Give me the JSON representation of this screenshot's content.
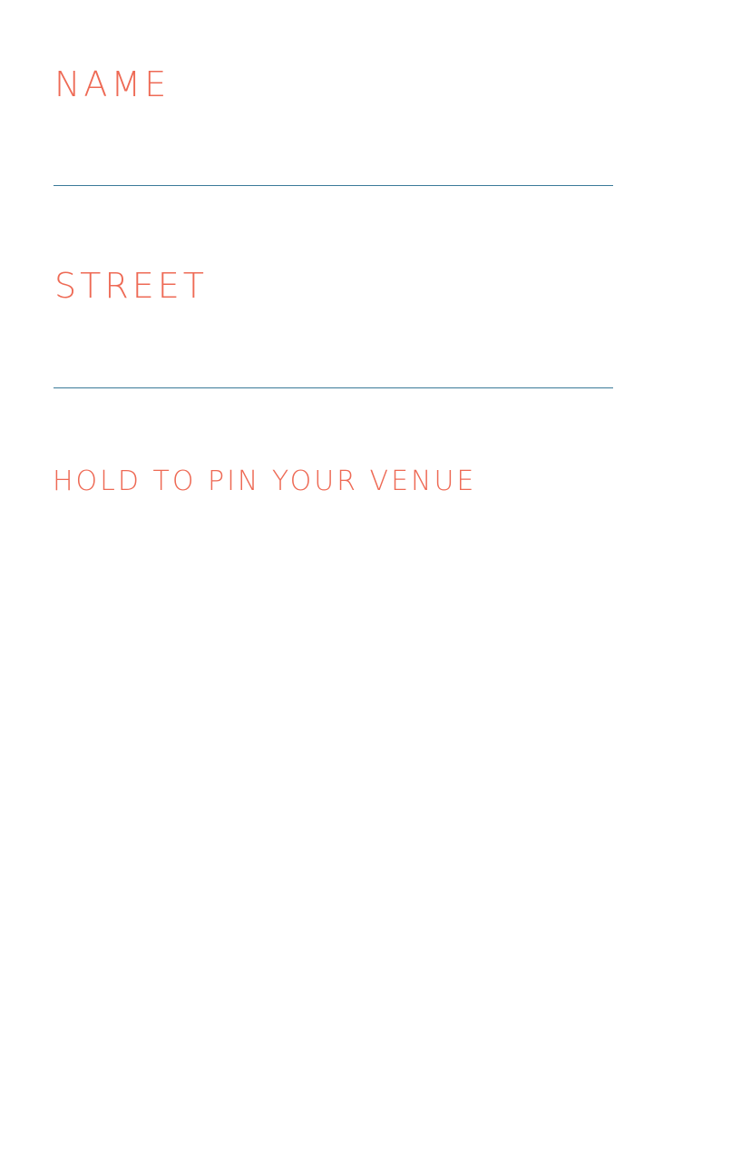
{
  "form": {
    "name": {
      "label": "NAME",
      "value": "",
      "placeholder": ""
    },
    "street": {
      "label": "STREET",
      "value": "",
      "placeholder": ""
    }
  },
  "map": {
    "hint": "HOLD TO PIN YOUR VENUE"
  },
  "colors": {
    "label": "#ee6a55",
    "underline": "#3a7a99",
    "background": "#ffffff"
  }
}
